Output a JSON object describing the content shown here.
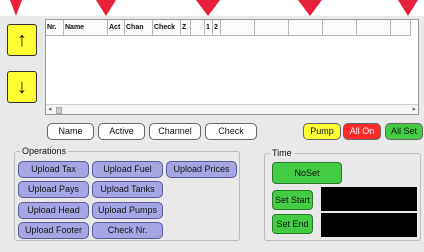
{
  "arrows": {
    "up_icon": "↑",
    "down_icon": "↓"
  },
  "grid": {
    "columns": [
      "Nr.",
      "Name",
      "Act",
      "Chan",
      "Check",
      "Z",
      "",
      "1",
      "2",
      "",
      "",
      "",
      "",
      "",
      ""
    ],
    "scroll_left_icon": "◂",
    "scroll_right_icon": "▸"
  },
  "columns_filter": {
    "name": "Name",
    "active": "Active",
    "channel": "Channel",
    "check": "Check"
  },
  "status_buttons": {
    "pump": "Pump",
    "all_on": "All On",
    "all_set": "All Set"
  },
  "operations": {
    "title": "Operations",
    "upload_tax": "Upload Tax",
    "upload_fuel": "Upload Fuel",
    "upload_prices": "Upload Prices",
    "upload_pays": "Upload Pays",
    "upload_tanks": "Upload Tanks",
    "upload_head": "Upload Head",
    "upload_pumps": "Upload Pumps",
    "upload_footer": "Upload Footer",
    "check_nr": "Check Nr."
  },
  "time": {
    "title": "Time",
    "no_set": "NoSet",
    "set_start": "Set Start",
    "set_end": "Set End"
  },
  "colors": {
    "accent_yellow": "#ffff33",
    "accent_red": "#ff2a2a",
    "accent_green": "#44cc44",
    "op_purple": "#a6a6e4"
  }
}
